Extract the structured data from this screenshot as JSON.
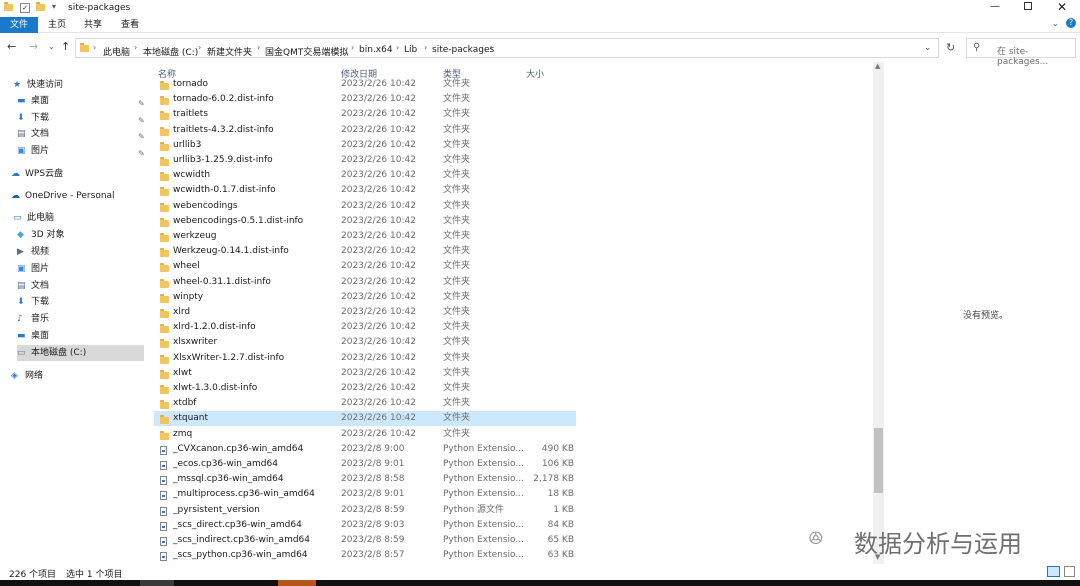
{
  "window": {
    "title": "site-packages",
    "minimize_icon": "minimize-icon",
    "maximize_icon": "maximize-icon",
    "close_icon": "close-icon"
  },
  "ribbon": {
    "tabs": [
      "文件",
      "主页",
      "共享",
      "查看"
    ],
    "active_color": "#1979ca"
  },
  "address": {
    "crumbs": [
      "此电脑",
      "本地磁盘 (C:)",
      "新建文件夹",
      "国金QMT交易端模拟",
      "bin.x64",
      "Lib",
      "site-packages"
    ],
    "search_placeholder": "在 site-packages..."
  },
  "nav": {
    "items": [
      {
        "label": "快速访问",
        "icon": "star-icon",
        "pinned": false
      },
      {
        "label": "桌面",
        "icon": "desktop-icon",
        "pinned": true
      },
      {
        "label": "下载",
        "icon": "download-icon",
        "pinned": true
      },
      {
        "label": "文档",
        "icon": "document-icon",
        "pinned": true
      },
      {
        "label": "图片",
        "icon": "picture-icon",
        "pinned": true
      },
      {
        "label": "WPS云盘",
        "icon": "cloud-icon",
        "pinned": false
      },
      {
        "label": "OneDrive - Personal",
        "icon": "onedrive-icon",
        "pinned": false
      },
      {
        "label": "此电脑",
        "icon": "pc-icon",
        "pinned": false
      },
      {
        "label": "3D 对象",
        "icon": "cube-icon",
        "pinned": false
      },
      {
        "label": "视频",
        "icon": "video-icon",
        "pinned": false
      },
      {
        "label": "图片",
        "icon": "picture-icon",
        "pinned": false
      },
      {
        "label": "文档",
        "icon": "document-icon",
        "pinned": false
      },
      {
        "label": "下载",
        "icon": "download-icon",
        "pinned": false
      },
      {
        "label": "音乐",
        "icon": "music-icon",
        "pinned": false
      },
      {
        "label": "桌面",
        "icon": "desktop-icon",
        "pinned": false
      },
      {
        "label": "本地磁盘 (C:)",
        "icon": "drive-icon",
        "pinned": false,
        "selected": true
      },
      {
        "label": "网络",
        "icon": "network-icon",
        "pinned": false
      }
    ]
  },
  "columns": {
    "name": "名称",
    "date": "修改日期",
    "type": "类型",
    "size": "大小"
  },
  "files": [
    {
      "name": "tornado",
      "date": "2023/2/26 10:42",
      "type": "文件夹",
      "size": "",
      "kind": "folder"
    },
    {
      "name": "tornado-6.0.2.dist-info",
      "date": "2023/2/26 10:42",
      "type": "文件夹",
      "size": "",
      "kind": "folder"
    },
    {
      "name": "traitlets",
      "date": "2023/2/26 10:42",
      "type": "文件夹",
      "size": "",
      "kind": "folder"
    },
    {
      "name": "traitlets-4.3.2.dist-info",
      "date": "2023/2/26 10:42",
      "type": "文件夹",
      "size": "",
      "kind": "folder"
    },
    {
      "name": "urllib3",
      "date": "2023/2/26 10:42",
      "type": "文件夹",
      "size": "",
      "kind": "folder"
    },
    {
      "name": "urllib3-1.25.9.dist-info",
      "date": "2023/2/26 10:42",
      "type": "文件夹",
      "size": "",
      "kind": "folder"
    },
    {
      "name": "wcwidth",
      "date": "2023/2/26 10:42",
      "type": "文件夹",
      "size": "",
      "kind": "folder"
    },
    {
      "name": "wcwidth-0.1.7.dist-info",
      "date": "2023/2/26 10:42",
      "type": "文件夹",
      "size": "",
      "kind": "folder"
    },
    {
      "name": "webencodings",
      "date": "2023/2/26 10:42",
      "type": "文件夹",
      "size": "",
      "kind": "folder"
    },
    {
      "name": "webencodings-0.5.1.dist-info",
      "date": "2023/2/26 10:42",
      "type": "文件夹",
      "size": "",
      "kind": "folder"
    },
    {
      "name": "werkzeug",
      "date": "2023/2/26 10:42",
      "type": "文件夹",
      "size": "",
      "kind": "folder"
    },
    {
      "name": "Werkzeug-0.14.1.dist-info",
      "date": "2023/2/26 10:42",
      "type": "文件夹",
      "size": "",
      "kind": "folder"
    },
    {
      "name": "wheel",
      "date": "2023/2/26 10:42",
      "type": "文件夹",
      "size": "",
      "kind": "folder"
    },
    {
      "name": "wheel-0.31.1.dist-info",
      "date": "2023/2/26 10:42",
      "type": "文件夹",
      "size": "",
      "kind": "folder"
    },
    {
      "name": "winpty",
      "date": "2023/2/26 10:42",
      "type": "文件夹",
      "size": "",
      "kind": "folder"
    },
    {
      "name": "xlrd",
      "date": "2023/2/26 10:42",
      "type": "文件夹",
      "size": "",
      "kind": "folder"
    },
    {
      "name": "xlrd-1.2.0.dist-info",
      "date": "2023/2/26 10:42",
      "type": "文件夹",
      "size": "",
      "kind": "folder"
    },
    {
      "name": "xlsxwriter",
      "date": "2023/2/26 10:42",
      "type": "文件夹",
      "size": "",
      "kind": "folder"
    },
    {
      "name": "XlsxWriter-1.2.7.dist-info",
      "date": "2023/2/26 10:42",
      "type": "文件夹",
      "size": "",
      "kind": "folder"
    },
    {
      "name": "xlwt",
      "date": "2023/2/26 10:42",
      "type": "文件夹",
      "size": "",
      "kind": "folder"
    },
    {
      "name": "xlwt-1.3.0.dist-info",
      "date": "2023/2/26 10:42",
      "type": "文件夹",
      "size": "",
      "kind": "folder"
    },
    {
      "name": "xtdbf",
      "date": "2023/2/26 10:42",
      "type": "文件夹",
      "size": "",
      "kind": "folder"
    },
    {
      "name": "xtquant",
      "date": "2023/2/26 10:42",
      "type": "文件夹",
      "size": "",
      "kind": "folder",
      "selected": true
    },
    {
      "name": "zmq",
      "date": "2023/2/26 10:42",
      "type": "文件夹",
      "size": "",
      "kind": "folder"
    },
    {
      "name": "_CVXcanon.cp36-win_amd64",
      "date": "2023/2/8 9:00",
      "type": "Python Extensio...",
      "size": "490 KB",
      "kind": "file"
    },
    {
      "name": "_ecos.cp36-win_amd64",
      "date": "2023/2/8 9:01",
      "type": "Python Extensio...",
      "size": "106 KB",
      "kind": "file"
    },
    {
      "name": "_mssql.cp36-win_amd64",
      "date": "2023/2/8 8:58",
      "type": "Python Extensio...",
      "size": "2,178 KB",
      "kind": "file"
    },
    {
      "name": "_multiprocess.cp36-win_amd64",
      "date": "2023/2/8 9:01",
      "type": "Python Extensio...",
      "size": "18 KB",
      "kind": "file"
    },
    {
      "name": "_pyrsistent_version",
      "date": "2023/2/8 8:59",
      "type": "Python 源文件",
      "size": "1 KB",
      "kind": "file"
    },
    {
      "name": "_scs_direct.cp36-win_amd64",
      "date": "2023/2/8 9:03",
      "type": "Python Extensio...",
      "size": "84 KB",
      "kind": "file"
    },
    {
      "name": "_scs_indirect.cp36-win_amd64",
      "date": "2023/2/8 8:59",
      "type": "Python Extensio...",
      "size": "65 KB",
      "kind": "file"
    },
    {
      "name": "_scs_python.cp36-win_amd64",
      "date": "2023/2/8 8:57",
      "type": "Python Extensio...",
      "size": "63 KB",
      "kind": "file"
    }
  ],
  "preview": {
    "text": "没有预览。"
  },
  "status": {
    "count": "226 个项目",
    "selection": "选中 1 个项目"
  },
  "watermark": {
    "text": "数据分析与运用"
  }
}
